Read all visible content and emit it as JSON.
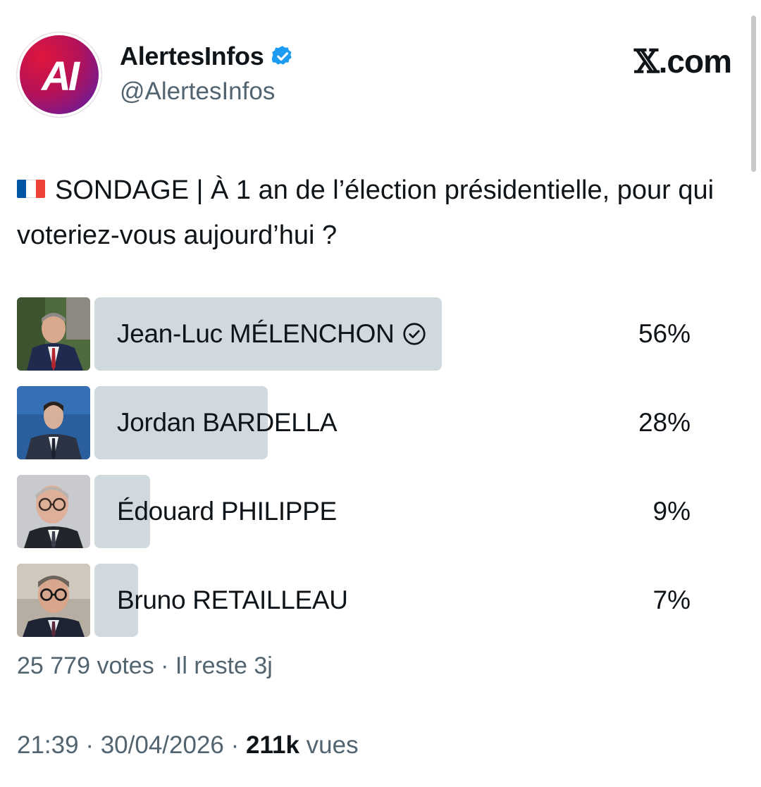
{
  "account": {
    "display_name": "AlertesInfos",
    "handle": "@AlertesInfos",
    "avatar_text": "AI",
    "verified_icon": "verified-badge-icon"
  },
  "brand": {
    "x_letter": "𝕏",
    "suffix": ".com"
  },
  "tweet": {
    "flag_icon": "france-flag-icon",
    "text": "SONDAGE | À 1 an de l’élection présidentielle, pour qui voteriez-vous aujourd’hui ?"
  },
  "poll": {
    "options": [
      {
        "label": "Jean-Luc MÉLENCHON",
        "percent_text": "56%",
        "percent": 56,
        "selected": true
      },
      {
        "label": "Jordan BARDELLA",
        "percent_text": "28%",
        "percent": 28,
        "selected": false
      },
      {
        "label": "Édouard PHILIPPE",
        "percent_text": "9%",
        "percent": 9,
        "selected": false
      },
      {
        "label": "Bruno RETAILLEAU",
        "percent_text": "7%",
        "percent": 7,
        "selected": false
      }
    ],
    "meta": "25 779 votes · Il reste 3j"
  },
  "footer": {
    "time": "21:39",
    "separator": " · ",
    "date": "30/04/2026",
    "views_count": "211k",
    "views_label": " vues"
  },
  "colors": {
    "poll_bar": "#cfd9de",
    "verified": "#1d9bf0",
    "secondary_text": "#536471",
    "avatar_red": "#e0163c",
    "avatar_purple": "#4a1fb5"
  }
}
